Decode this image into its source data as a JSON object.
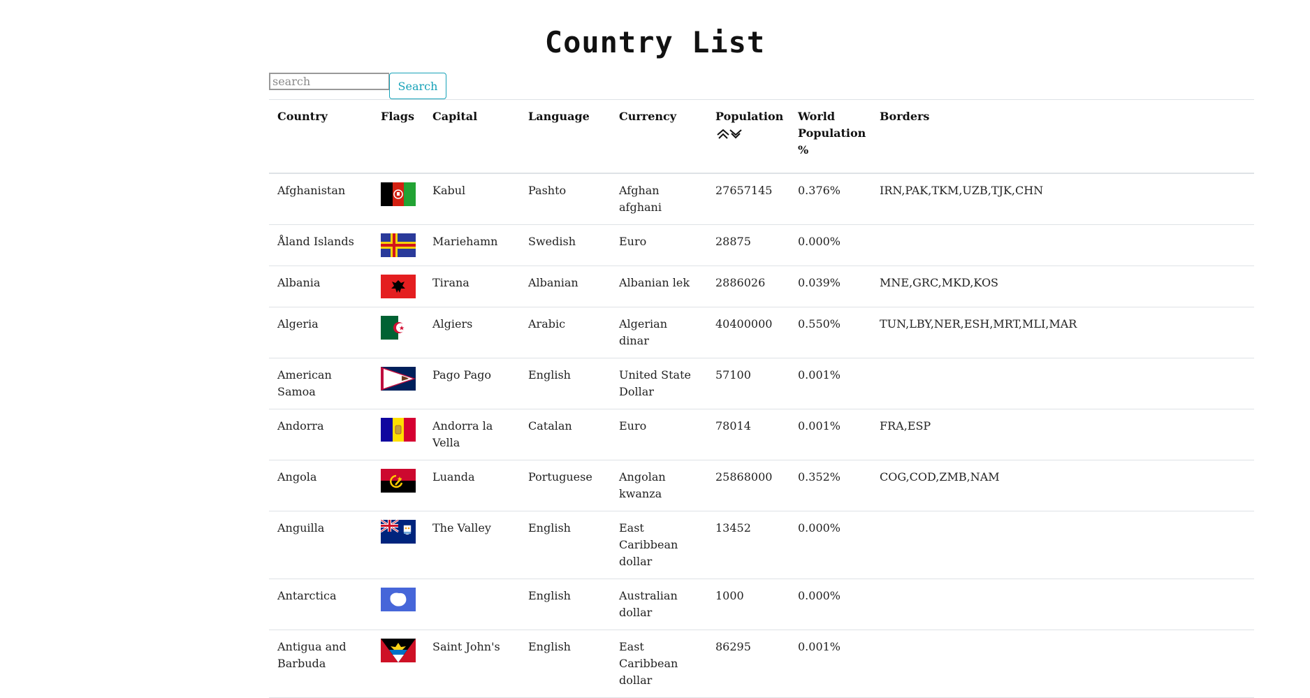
{
  "title": "Country List",
  "search": {
    "placeholder": "search",
    "value": "",
    "button_label": "Search"
  },
  "table": {
    "headers": {
      "country": "Country",
      "flags": "Flags",
      "capital": "Capital",
      "language": "Language",
      "currency": "Currency",
      "population": "Population",
      "world_population": "World Population %",
      "borders": "Borders"
    },
    "rows": [
      {
        "country": "Afghanistan",
        "flag_icon": "afghanistan-flag",
        "capital": "Kabul",
        "language": "Pashto",
        "currency": "Afghan afghani",
        "population": "27657145",
        "world_pct": "0.376%",
        "borders": "IRN,PAK,TKM,UZB,TJK,CHN"
      },
      {
        "country": "Åland Islands",
        "flag_icon": "aland-islands-flag",
        "capital": "Mariehamn",
        "language": "Swedish",
        "currency": "Euro",
        "population": "28875",
        "world_pct": "0.000%",
        "borders": ""
      },
      {
        "country": "Albania",
        "flag_icon": "albania-flag",
        "capital": "Tirana",
        "language": "Albanian",
        "currency": "Albanian lek",
        "population": "2886026",
        "world_pct": "0.039%",
        "borders": "MNE,GRC,MKD,KOS"
      },
      {
        "country": "Algeria",
        "flag_icon": "algeria-flag",
        "capital": "Algiers",
        "language": "Arabic",
        "currency": "Algerian dinar",
        "population": "40400000",
        "world_pct": "0.550%",
        "borders": "TUN,LBY,NER,ESH,MRT,MLI,MAR"
      },
      {
        "country": "American Samoa",
        "flag_icon": "american-samoa-flag",
        "capital": "Pago Pago",
        "language": "English",
        "currency": "United State Dollar",
        "population": "57100",
        "world_pct": "0.001%",
        "borders": ""
      },
      {
        "country": "Andorra",
        "flag_icon": "andorra-flag",
        "capital": "Andorra la Vella",
        "language": "Catalan",
        "currency": "Euro",
        "population": "78014",
        "world_pct": "0.001%",
        "borders": "FRA,ESP"
      },
      {
        "country": "Angola",
        "flag_icon": "angola-flag",
        "capital": "Luanda",
        "language": "Portuguese",
        "currency": "Angolan kwanza",
        "population": "25868000",
        "world_pct": "0.352%",
        "borders": "COG,COD,ZMB,NAM"
      },
      {
        "country": "Anguilla",
        "flag_icon": "anguilla-flag",
        "capital": "The Valley",
        "language": "English",
        "currency": "East Caribbean dollar",
        "population": "13452",
        "world_pct": "0.000%",
        "borders": ""
      },
      {
        "country": "Antarctica",
        "flag_icon": "antarctica-flag",
        "capital": "",
        "language": "English",
        "currency": "Australian dollar",
        "population": "1000",
        "world_pct": "0.000%",
        "borders": ""
      },
      {
        "country": "Antigua and Barbuda",
        "flag_icon": "antigua-and-barbuda-flag",
        "capital": "Saint John's",
        "language": "English",
        "currency": "East Caribbean dollar",
        "population": "86295",
        "world_pct": "0.001%",
        "borders": ""
      }
    ]
  },
  "colors": {
    "accent": "#17a2b8",
    "border": "#dee2e6",
    "text": "#222222"
  }
}
